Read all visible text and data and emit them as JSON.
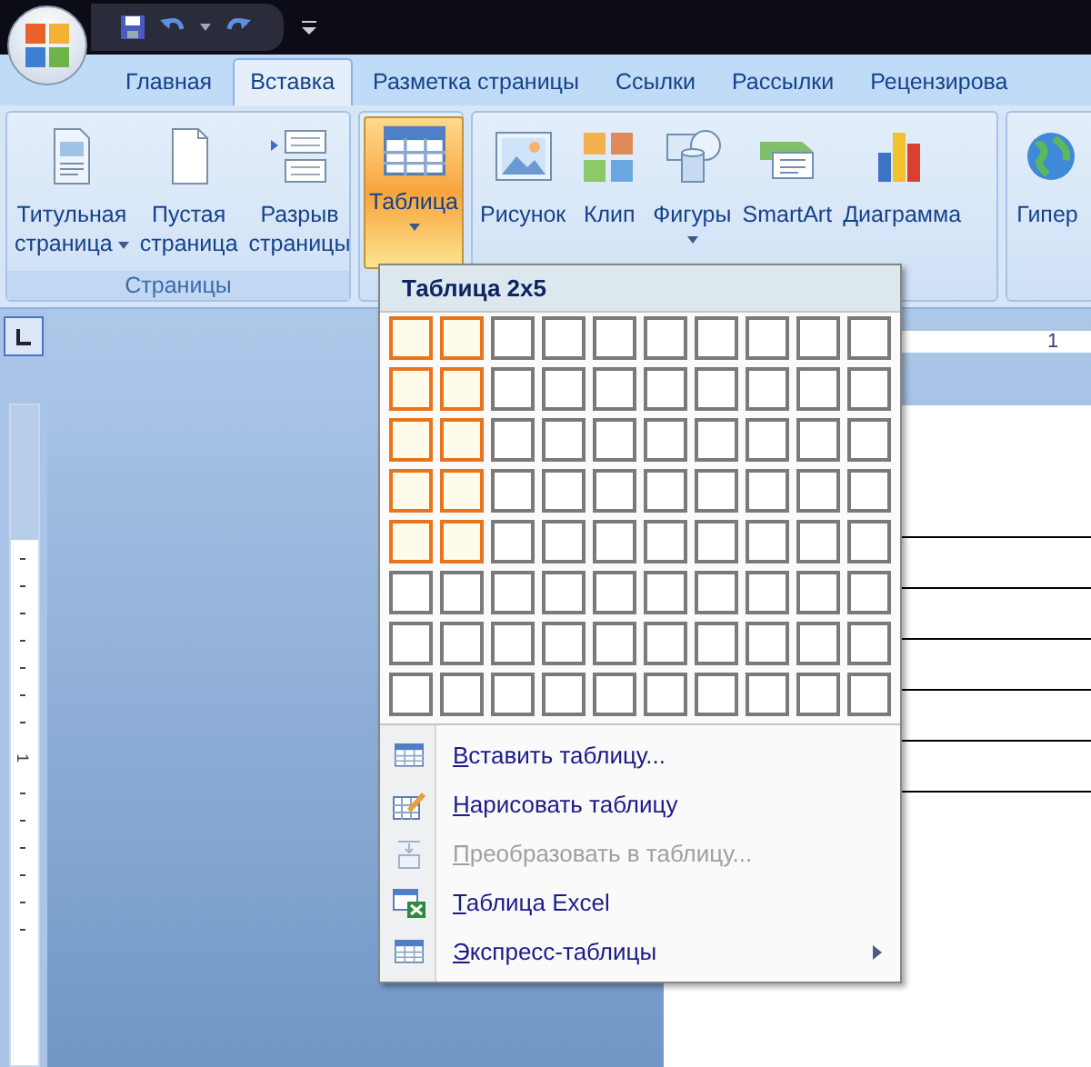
{
  "tabs": [
    {
      "label": "Главная",
      "selected": false
    },
    {
      "label": "Вставка",
      "selected": true
    },
    {
      "label": "Разметка страницы",
      "selected": false
    },
    {
      "label": "Ссылки",
      "selected": false
    },
    {
      "label": "Рассылки",
      "selected": false
    },
    {
      "label": "Рецензирова",
      "selected": false
    }
  ],
  "ribbon_groups": [
    {
      "label": "Страницы",
      "buttons": [
        {
          "lines": [
            "Титульная",
            "страница"
          ],
          "dropdown": true,
          "selected": false
        },
        {
          "lines": [
            "Пустая",
            "страница"
          ],
          "dropdown": false,
          "selected": false
        },
        {
          "lines": [
            "Разрыв",
            "страницы"
          ],
          "dropdown": false,
          "selected": false
        }
      ]
    },
    {
      "buttons": [
        {
          "lines": [
            "Таблица"
          ],
          "dropdown": true,
          "selected": true
        }
      ]
    },
    {
      "buttons": [
        {
          "lines": [
            "Рисунок"
          ],
          "dropdown": false,
          "selected": false
        },
        {
          "lines": [
            "Клип"
          ],
          "dropdown": false,
          "selected": false
        },
        {
          "lines": [
            "Фигуры"
          ],
          "dropdown": true,
          "selected": false
        },
        {
          "lines": [
            "SmartArt"
          ],
          "dropdown": false,
          "selected": false
        },
        {
          "lines": [
            "Диаграмма"
          ],
          "dropdown": false,
          "selected": false
        }
      ]
    },
    {
      "buttons": [
        {
          "lines": [
            "Гипер"
          ],
          "dropdown": false,
          "selected": false
        }
      ]
    }
  ],
  "ruler": {
    "horizontal_labels": [
      "1"
    ],
    "vertical_labels": [
      "1"
    ]
  },
  "table_menu": {
    "title": "Таблица 2x5",
    "grid": [
      {
        "cells": [
          {
            "selected": true
          },
          {
            "selected": true
          },
          {
            "selected": false
          },
          {
            "selected": false
          },
          {
            "selected": false
          },
          {
            "selected": false
          },
          {
            "selected": false
          },
          {
            "selected": false
          },
          {
            "selected": false
          },
          {
            "selected": false
          }
        ]
      },
      {
        "cells": [
          {
            "selected": true
          },
          {
            "selected": true
          },
          {
            "selected": false
          },
          {
            "selected": false
          },
          {
            "selected": false
          },
          {
            "selected": false
          },
          {
            "selected": false
          },
          {
            "selected": false
          },
          {
            "selected": false
          },
          {
            "selected": false
          }
        ]
      },
      {
        "cells": [
          {
            "selected": true
          },
          {
            "selected": true
          },
          {
            "selected": false
          },
          {
            "selected": false
          },
          {
            "selected": false
          },
          {
            "selected": false
          },
          {
            "selected": false
          },
          {
            "selected": false
          },
          {
            "selected": false
          },
          {
            "selected": false
          }
        ]
      },
      {
        "cells": [
          {
            "selected": true
          },
          {
            "selected": true
          },
          {
            "selected": false
          },
          {
            "selected": false
          },
          {
            "selected": false
          },
          {
            "selected": false
          },
          {
            "selected": false
          },
          {
            "selected": false
          },
          {
            "selected": false
          },
          {
            "selected": false
          }
        ]
      },
      {
        "cells": [
          {
            "selected": true
          },
          {
            "selected": true
          },
          {
            "selected": false
          },
          {
            "selected": false
          },
          {
            "selected": false
          },
          {
            "selected": false
          },
          {
            "selected": false
          },
          {
            "selected": false
          },
          {
            "selected": false
          },
          {
            "selected": false
          }
        ]
      },
      {
        "cells": [
          {
            "selected": false
          },
          {
            "selected": false
          },
          {
            "selected": false
          },
          {
            "selected": false
          },
          {
            "selected": false
          },
          {
            "selected": false
          },
          {
            "selected": false
          },
          {
            "selected": false
          },
          {
            "selected": false
          },
          {
            "selected": false
          }
        ]
      },
      {
        "cells": [
          {
            "selected": false
          },
          {
            "selected": false
          },
          {
            "selected": false
          },
          {
            "selected": false
          },
          {
            "selected": false
          },
          {
            "selected": false
          },
          {
            "selected": false
          },
          {
            "selected": false
          },
          {
            "selected": false
          },
          {
            "selected": false
          }
        ]
      },
      {
        "cells": [
          {
            "selected": false
          },
          {
            "selected": false
          },
          {
            "selected": false
          },
          {
            "selected": false
          },
          {
            "selected": false
          },
          {
            "selected": false
          },
          {
            "selected": false
          },
          {
            "selected": false
          },
          {
            "selected": false
          },
          {
            "selected": false
          }
        ]
      }
    ],
    "items": [
      {
        "label": "Вставить таблицу...",
        "disabled": false,
        "submenu": false
      },
      {
        "label": "Нарисовать таблицу",
        "disabled": false,
        "submenu": false
      },
      {
        "label": "Преобразовать в таблицу...",
        "disabled": true,
        "submenu": false
      },
      {
        "label": "Таблица Excel",
        "disabled": false,
        "submenu": false
      },
      {
        "label": "Экспресс-таблицы",
        "disabled": false,
        "submenu": true
      }
    ]
  }
}
